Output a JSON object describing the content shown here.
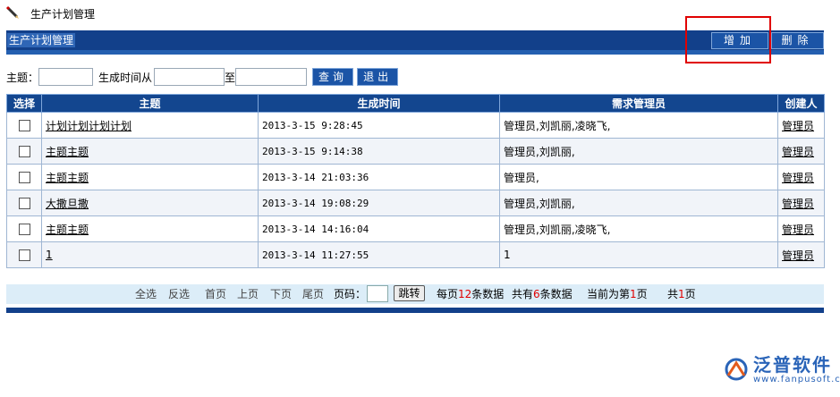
{
  "header": {
    "title": "生产计划管理"
  },
  "toolbar": {
    "section_title": "生产计划管理",
    "add_label": "增加",
    "delete_label": "删除"
  },
  "search": {
    "subject_label": "主题：",
    "subject_value": "",
    "time_from_label": "生成时间从",
    "from_value": "",
    "to_label": "至",
    "to_value": "",
    "query_label": "查询",
    "exit_label": "退出"
  },
  "table": {
    "headers": {
      "select": "选择",
      "subject": "主题",
      "time": "生成时间",
      "managers": "需求管理员",
      "creator": "创建人"
    },
    "rows": [
      {
        "subject": "计划计划计划计划",
        "time": "2013-3-15 9:28:45",
        "managers": "管理员,刘凯丽,凌晓飞,",
        "creator": "管理员"
      },
      {
        "subject": "主题主题",
        "time": "2013-3-15 9:14:38",
        "managers": "管理员,刘凯丽,",
        "creator": "管理员"
      },
      {
        "subject": "主题主题",
        "time": "2013-3-14 21:03:36",
        "managers": "管理员,",
        "creator": "管理员"
      },
      {
        "subject": "大撒旦撒",
        "time": "2013-3-14 19:08:29",
        "managers": "管理员,刘凯丽,",
        "creator": "管理员"
      },
      {
        "subject": "主题主题",
        "time": "2013-3-14 14:16:04",
        "managers": "管理员,刘凯丽,凌晓飞,",
        "creator": "管理员"
      },
      {
        "subject": "1",
        "time": "2013-3-14 11:27:55",
        "managers": "1",
        "creator": "管理员"
      }
    ]
  },
  "pager": {
    "select_all": "全选",
    "invert": "反选",
    "first": "首页",
    "prev": "上页",
    "next": "下页",
    "last": "尾页",
    "page_label": "页码：",
    "jump": "跳转",
    "per_page_prefix": "每页",
    "per_page": "12",
    "per_page_suffix": "条数据",
    "total_prefix": "共有",
    "total": "6",
    "total_suffix": "条数据",
    "current_prefix": "当前为第",
    "current": "1",
    "current_suffix": "页",
    "pages_prefix": "共",
    "pages": "1",
    "pages_suffix": "页"
  },
  "logo": {
    "name": "泛普软件",
    "url": "www.fanpusoft.com"
  },
  "colors": {
    "header_blue": "#12408a",
    "highlight_red": "#e00000",
    "logo_blue": "#2a64b8"
  }
}
